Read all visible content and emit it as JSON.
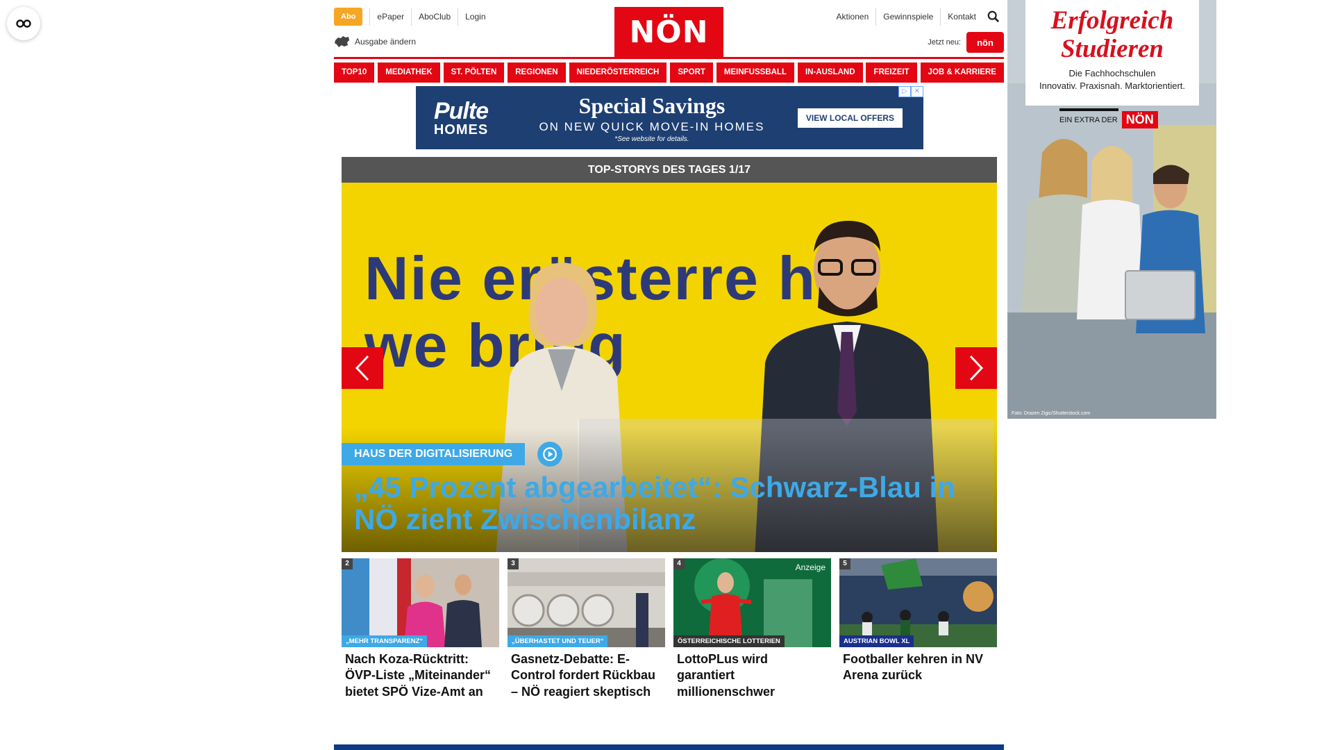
{
  "accessibility": {
    "icon": "glasses-icon"
  },
  "header": {
    "abo_label": "Abo",
    "links_left": [
      "ePaper",
      "AboClub",
      "Login"
    ],
    "edition_label": "Ausgabe ändern",
    "logo_text": "NÖN",
    "links_right": [
      "Aktionen",
      "Gewinnspiele",
      "Kontakt"
    ],
    "jetzt_label": "Jetzt neu:",
    "jetzt_badge": "nön"
  },
  "nav": {
    "items": [
      "TOP10",
      "MEDIATHEK",
      "ST. PÖLTEN",
      "REGIONEN",
      "NIEDERÖSTERREICH",
      "SPORT",
      "MEINFUSSBALL",
      "IN-AUSLAND",
      "FREIZEIT",
      "JOB & KARRIERE"
    ]
  },
  "banner_ad": {
    "brand_top": "Pulte",
    "brand_bottom": "HOMES",
    "title": "Special Savings",
    "subtitle": "ON NEW QUICK MOVE-IN HOMES",
    "note": "*See website for details.",
    "button": "VIEW LOCAL OFFERS"
  },
  "slider": {
    "header": "TOP-STORYS DES TAGES 1/17",
    "backdrop_text_line1": "Nie erösterre h",
    "backdrop_text_line2": "we  bring",
    "kicker": "HAUS DER DIGITALISIERUNG",
    "title": "„45 Prozent abgearbeitet“: Schwarz-Blau in NÖ zieht Zwischenbilanz"
  },
  "teasers": [
    {
      "num": "2",
      "tag": "„MEHR TRANSPARENZ“",
      "tag_color": "#3ea9e6",
      "title": "Nach Koza-Rücktritt: ÖVP-Liste „Miteinander“ bietet SPÖ Vize-Amt an",
      "anzeige": ""
    },
    {
      "num": "3",
      "tag": "„ÜBERHASTET UND TEUER“",
      "tag_color": "#3ea9e6",
      "title": "Gasnetz-Debatte: E-Control fordert Rückbau – NÖ reagiert skeptisch",
      "anzeige": ""
    },
    {
      "num": "4",
      "tag": "ÖSTERREICHISCHE LOTTERIEN",
      "tag_color": "#333333",
      "title": "LottoPLus wird garantiert millionenschwer",
      "anzeige": "Anzeige"
    },
    {
      "num": "5",
      "tag": "AUSTRIAN BOWL XL",
      "tag_color": "#1a2f8a",
      "title": "Footballer kehren in NV Arena zurück",
      "anzeige": ""
    }
  ],
  "side_ad": {
    "title_line1": "Erfolgreich",
    "title_line2": "Studieren",
    "sub_line1": "Die Fachhochschulen",
    "sub_line2": "Innovativ. Praxisnah. Marktorientiert.",
    "extra_label": "EIN EXTRA DER",
    "extra_logo": "NÖN",
    "credit": "Foto: Drazen Zigic/Shutterstock.com"
  },
  "colors": {
    "brand_red": "#e30613",
    "accent_blue": "#3ea9e6",
    "abo_orange": "#f5a623",
    "footer_blue": "#0e3a87"
  }
}
